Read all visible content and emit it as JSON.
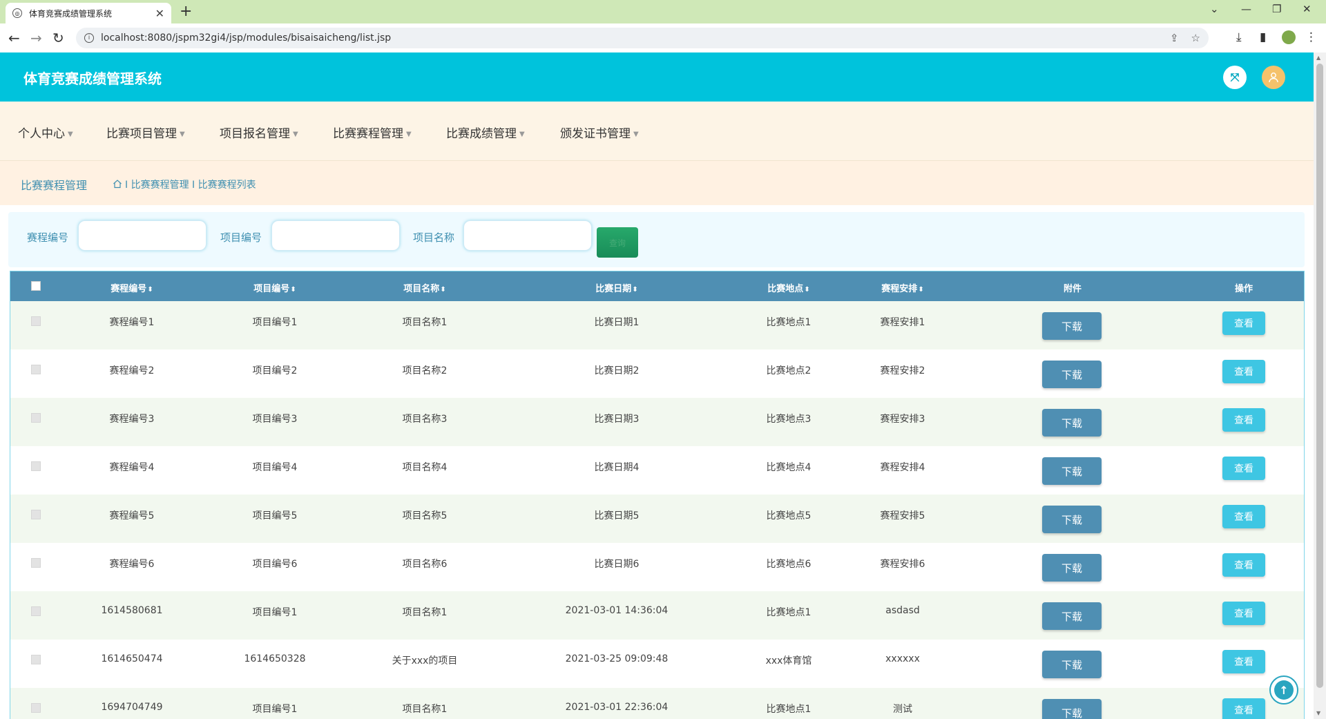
{
  "browser": {
    "tab_title": "体育竞赛成绩管理系统",
    "url": "localhost:8080/jspm32gi4/jsp/modules/bisaisaicheng/list.jsp"
  },
  "header": {
    "title": "体育竞赛成绩管理系统"
  },
  "nav": {
    "items": [
      "个人中心",
      "比赛项目管理",
      "项目报名管理",
      "比赛赛程管理",
      "比赛成绩管理",
      "颁发证书管理"
    ]
  },
  "breadcrumb": {
    "section": "比赛赛程管理",
    "path": "I 比赛赛程管理 I 比赛赛程列表"
  },
  "search": {
    "label_schedule_no": "赛程编号",
    "label_project_no": "项目编号",
    "label_project_name": "项目名称",
    "button_label": "查询"
  },
  "table": {
    "headers": {
      "schedule_no": "赛程编号",
      "project_no": "项目编号",
      "project_name": "项目名称",
      "date": "比赛日期",
      "location": "比赛地点",
      "arrangement": "赛程安排",
      "attachment": "附件",
      "action": "操作"
    },
    "download_label": "下载",
    "view_label": "查看",
    "rows": [
      {
        "schedule_no": "赛程编号1",
        "project_no": "项目编号1",
        "project_name": "项目名称1",
        "date": "比赛日期1",
        "location": "比赛地点1",
        "arrangement": "赛程安排1"
      },
      {
        "schedule_no": "赛程编号2",
        "project_no": "项目编号2",
        "project_name": "项目名称2",
        "date": "比赛日期2",
        "location": "比赛地点2",
        "arrangement": "赛程安排2"
      },
      {
        "schedule_no": "赛程编号3",
        "project_no": "项目编号3",
        "project_name": "项目名称3",
        "date": "比赛日期3",
        "location": "比赛地点3",
        "arrangement": "赛程安排3"
      },
      {
        "schedule_no": "赛程编号4",
        "project_no": "项目编号4",
        "project_name": "项目名称4",
        "date": "比赛日期4",
        "location": "比赛地点4",
        "arrangement": "赛程安排4"
      },
      {
        "schedule_no": "赛程编号5",
        "project_no": "项目编号5",
        "project_name": "项目名称5",
        "date": "比赛日期5",
        "location": "比赛地点5",
        "arrangement": "赛程安排5"
      },
      {
        "schedule_no": "赛程编号6",
        "project_no": "项目编号6",
        "project_name": "项目名称6",
        "date": "比赛日期6",
        "location": "比赛地点6",
        "arrangement": "赛程安排6"
      },
      {
        "schedule_no": "1614580681",
        "project_no": "项目编号1",
        "project_name": "项目名称1",
        "date": "2021-03-01 14:36:04",
        "location": "比赛地点1",
        "arrangement": "asdasd"
      },
      {
        "schedule_no": "1614650474",
        "project_no": "1614650328",
        "project_name": "关于xxx的项目",
        "date": "2021-03-25 09:09:48",
        "location": "xxx体育馆",
        "arrangement": "xxxxxx"
      },
      {
        "schedule_no": "1694704749",
        "project_no": "项目编号1",
        "project_name": "项目名称1",
        "date": "2021-03-01 22:36:04",
        "location": "比赛地点1",
        "arrangement": "测试"
      }
    ]
  },
  "colors": {
    "header_bg": "#00c3dc",
    "table_header_bg": "#4f8fb3",
    "view_button_bg": "#3ec6e3",
    "search_button_bg": "#198c58"
  }
}
